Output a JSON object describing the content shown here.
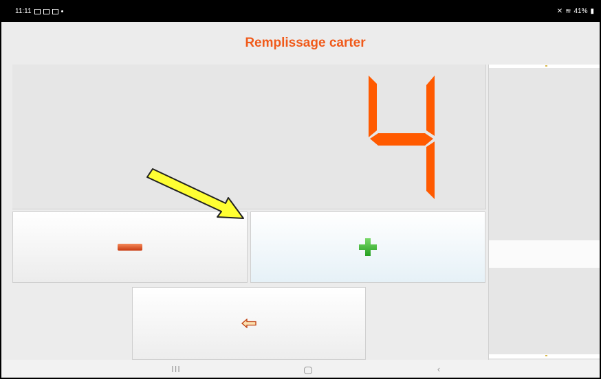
{
  "status_bar": {
    "time": "11:11",
    "right_text": "41%"
  },
  "header": {
    "title": "Remplissage carter"
  },
  "display": {
    "value": "4",
    "digit_color": "#ff5a00"
  },
  "buttons": {
    "decrease_icon": "minus-icon",
    "increase_icon": "plus-icon",
    "back_icon": "back-arrow-icon"
  },
  "nav_bar": {
    "recents_label": "III",
    "back_label": "‹"
  },
  "colors": {
    "title": "#f05a1a",
    "minus": "#e05020",
    "plus": "#3cb832",
    "annotation_arrow": "#ffff33"
  }
}
